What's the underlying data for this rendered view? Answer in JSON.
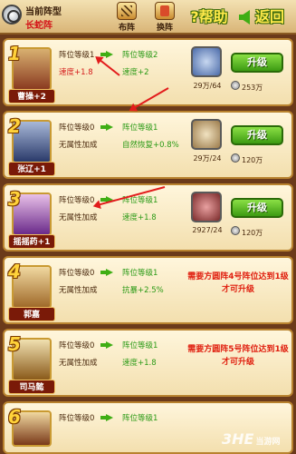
{
  "header": {
    "formation_label": "当前阵型",
    "formation_value": "长蛇阵",
    "deploy_label": "布阵",
    "swap_label": "换阵",
    "help_label": "?帮助",
    "back_label": "返回"
  },
  "slots": [
    {
      "number": "1",
      "hero_name": "曹操+2",
      "level_current": "阵位等级1",
      "level_next": "阵位等级2",
      "bonus_current": "速度+1.8",
      "bonus_next": "速度+2",
      "item_count": "29万/64",
      "upgrade_label": "升级",
      "cost": "253万",
      "requirement": ""
    },
    {
      "number": "2",
      "hero_name": "张辽+1",
      "level_current": "阵位等级0",
      "level_next": "阵位等级1",
      "bonus_current": "无属性加成",
      "bonus_next": "自然恢复+0.8%",
      "item_count": "29万/24",
      "upgrade_label": "升级",
      "cost": "120万",
      "requirement": ""
    },
    {
      "number": "3",
      "hero_name": "摇摇药+1",
      "level_current": "阵位等级0",
      "level_next": "阵位等级1",
      "bonus_current": "无属性加成",
      "bonus_next": "速度+1.8",
      "item_count": "2927/24",
      "upgrade_label": "升级",
      "cost": "120万",
      "requirement": ""
    },
    {
      "number": "4",
      "hero_name": "郭嘉",
      "level_current": "阵位等级0",
      "level_next": "阵位等级1",
      "bonus_current": "无属性加成",
      "bonus_next": "抗暴+2.5%",
      "item_count": "",
      "upgrade_label": "",
      "cost": "",
      "requirement": "需要方圆阵4号阵位达到1级才可升级"
    },
    {
      "number": "5",
      "hero_name": "司马懿",
      "level_current": "阵位等级0",
      "level_next": "阵位等级1",
      "bonus_current": "无属性加成",
      "bonus_next": "速度+1.8",
      "item_count": "",
      "upgrade_label": "",
      "cost": "",
      "requirement": "需要方圆阵5号阵位达到1级才可升级"
    },
    {
      "number": "6",
      "hero_name": "",
      "level_current": "阵位等级0",
      "level_next": "阵位等级1",
      "bonus_current": "",
      "bonus_next": "",
      "item_count": "",
      "upgrade_label": "",
      "cost": "",
      "requirement": ""
    }
  ],
  "watermark": {
    "text": "3HE",
    "sub": "当游网"
  },
  "colors": {
    "accent_green": "#3fae14",
    "warning_red": "#e02010",
    "panel_border": "#b9832f"
  }
}
